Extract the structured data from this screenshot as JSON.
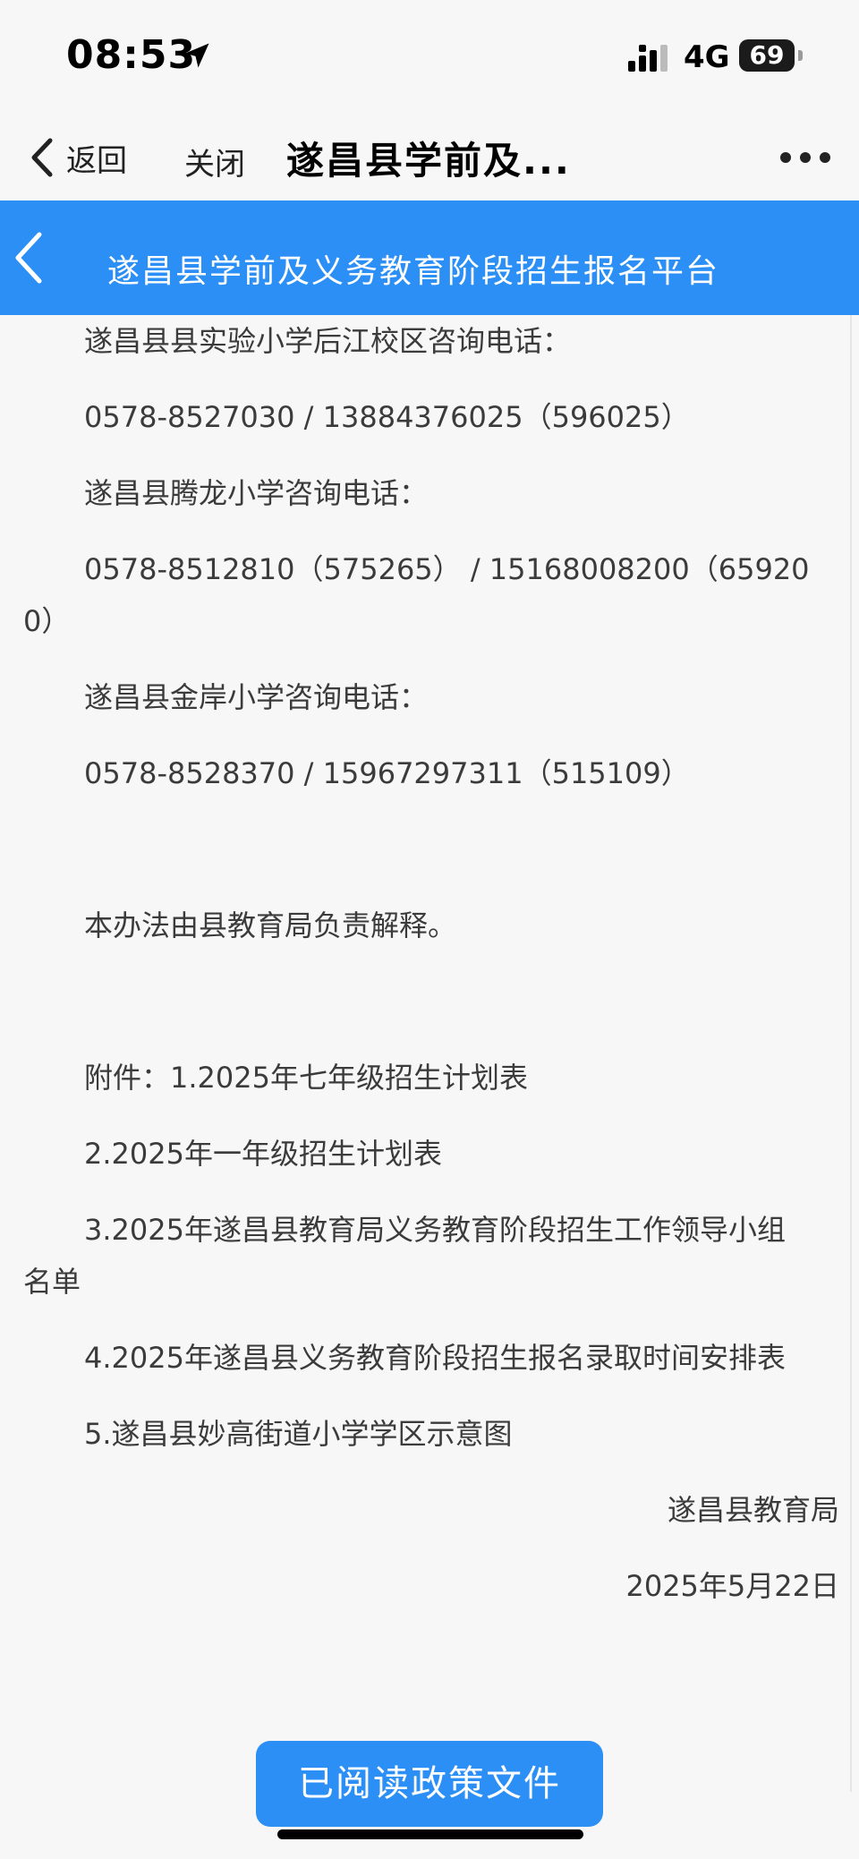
{
  "status_bar": {
    "time": "08:53",
    "network": "4G",
    "battery": "69",
    "icons": [
      "location-arrow-icon",
      "signal-bars-icon"
    ]
  },
  "nav": {
    "back_label": "返回",
    "close_label": "关闭",
    "title": "遂昌县学前及...",
    "more_icon": "more-dots-icon"
  },
  "header": {
    "title": "遂昌县学前及义务教育阶段招生报名平台",
    "color": "#2b8ff5"
  },
  "content": {
    "lines": [
      "遂昌县县实验小学后江校区咨询电话：",
      "0578-8527030 / 13884376025（596025）",
      "遂昌县腾龙小学咨询电话：",
      "0578-8512810（575265） / 15168008200（65920",
      "0）",
      "遂昌县金岸小学咨询电话：",
      "0578-8528370 / 15967297311（515109）",
      "本办法由县教育局负责解释。",
      "附件：1.2025年七年级招生计划表",
      "2.2025年一年级招生计划表",
      "3.2025年遂昌县教育局义务教育阶段招生工作领导小组",
      "名单",
      "4.2025年遂昌县义务教育阶段招生报名录取时间安排表",
      "5.遂昌县妙高街道小学学区示意图",
      "遂昌县教育局",
      "2025年5月22日"
    ]
  },
  "footer": {
    "read_button": "已阅读政策文件"
  }
}
